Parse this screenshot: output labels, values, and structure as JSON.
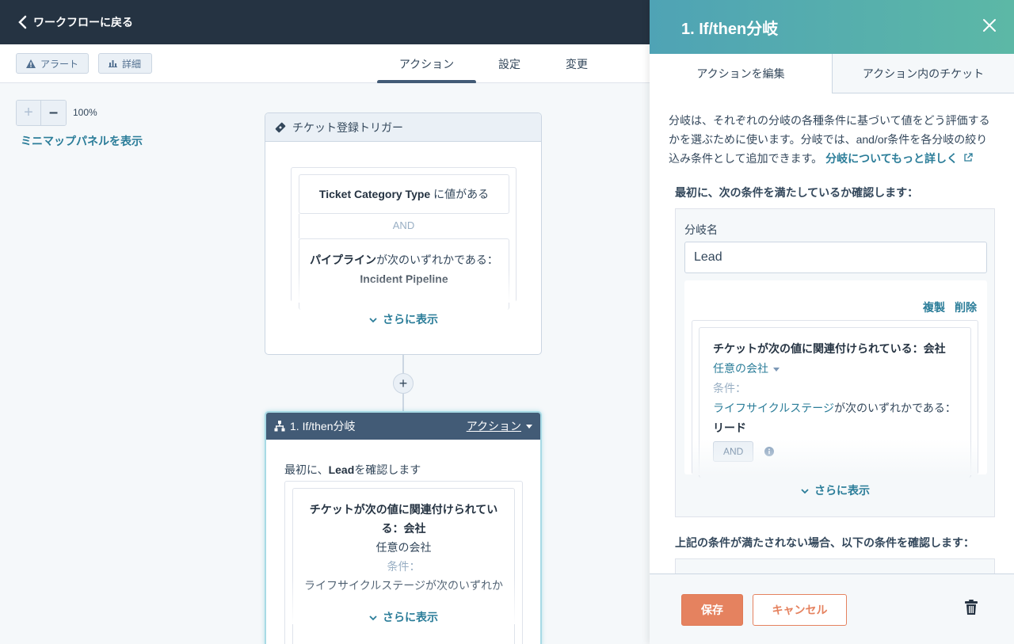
{
  "topbar": {
    "back_label": "ワークフローに戻る"
  },
  "toolbar": {
    "alert_label": "アラート",
    "detail_label": "詳細"
  },
  "tabs": [
    {
      "label": "アクション",
      "active": true
    },
    {
      "label": "設定",
      "active": false
    },
    {
      "label": "変更",
      "active": false
    }
  ],
  "canvas": {
    "zoom_level": "100%",
    "minimap_label": "ミニマップパネルを表示",
    "trigger": {
      "title": "チケット登録トリガー",
      "filter1_bold": "Ticket Category Type",
      "filter1_rest": " に値がある",
      "and_label": "AND",
      "filter2_bold": "パイプライン",
      "filter2_rest": "が次のいずれかである：",
      "filter2_value": "Incident Pipeline",
      "show_more": "さらに表示"
    },
    "branch": {
      "title": "1. If/then分岐",
      "action_label": "アクション",
      "intro_prefix": "最初に、",
      "intro_bold": "Lead",
      "intro_suffix": "を確認します",
      "cond_title_line1": "チケットが次の値に関連付けられてい",
      "cond_title_line2": "る：会社",
      "cond_any": "任意の会社",
      "cond_label": "条件：",
      "cond_prop": "ライフサイクルステージが次のいずれか",
      "show_more": "さらに表示"
    }
  },
  "panel": {
    "title": "1. If/then分岐",
    "tabs": [
      {
        "label": "アクションを編集",
        "active": true
      },
      {
        "label": "アクション内のチケット",
        "active": false
      }
    ],
    "description": "分岐は、それぞれの分岐の各種条件に基づいて値をどう評価するかを選ぶために使います。分岐では、and/or条件を各分岐の絞り込み条件として追加できます。",
    "learn_more": "分岐についてもっと詳しく",
    "first_check_label": "最初に、次の条件を満たしているか確認します：",
    "branch_name_label": "分岐名",
    "branch_name_value": "Lead",
    "duplicate_label": "複製",
    "delete_label": "削除",
    "condition": {
      "title": "チケットが次の値に関連付けられている：会社",
      "any_company": "任意の会社",
      "cond_label": "条件：",
      "property": "ライフサイクルステージ",
      "operator": "が次のいずれかである：",
      "value": "リード",
      "and_button": "AND"
    },
    "show_more": "さらに表示",
    "else_check_label": "上記の条件が満たされない場合、以下の条件を確認します：",
    "save_label": "保存",
    "cancel_label": "キャンセル"
  }
}
